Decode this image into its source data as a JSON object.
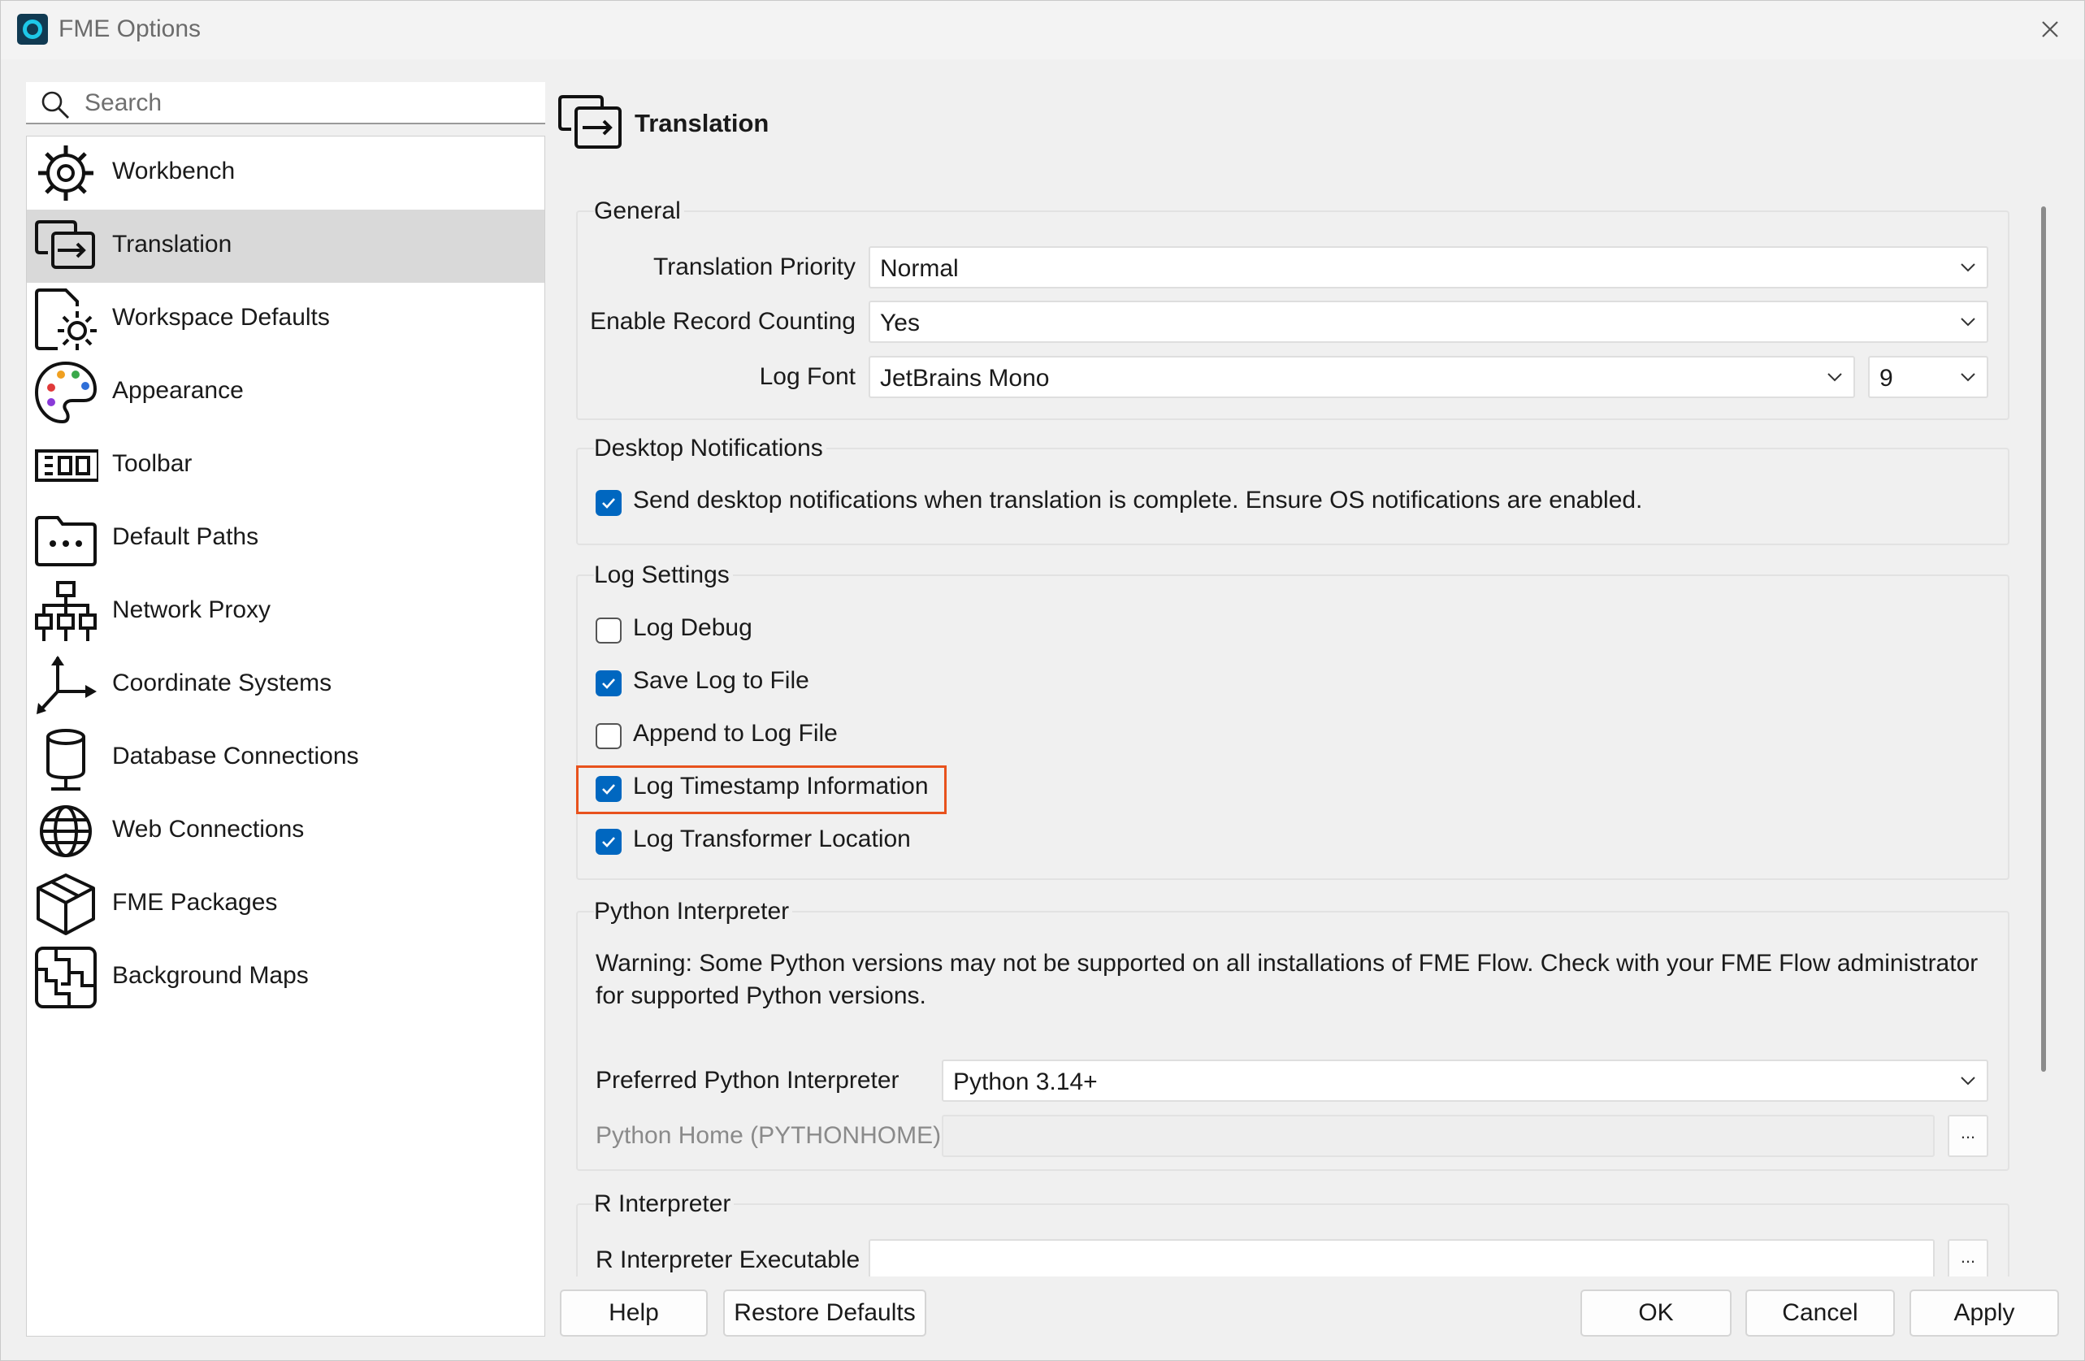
{
  "window": {
    "title": "FME Options"
  },
  "sidebar": {
    "search_placeholder": "Search",
    "items": [
      {
        "label": "Workbench",
        "icon": "workbench-icon"
      },
      {
        "label": "Translation",
        "icon": "translation-icon",
        "selected": true
      },
      {
        "label": "Workspace Defaults",
        "icon": "workspace-defaults-icon"
      },
      {
        "label": "Appearance",
        "icon": "palette-icon"
      },
      {
        "label": "Toolbar",
        "icon": "toolbar-icon"
      },
      {
        "label": "Default Paths",
        "icon": "folder-icon"
      },
      {
        "label": "Network Proxy",
        "icon": "network-icon"
      },
      {
        "label": "Coordinate Systems",
        "icon": "axes-icon"
      },
      {
        "label": "Database Connections",
        "icon": "database-icon"
      },
      {
        "label": "Web Connections",
        "icon": "globe-icon"
      },
      {
        "label": "FME Packages",
        "icon": "package-icon"
      },
      {
        "label": "Background Maps",
        "icon": "map-icon"
      }
    ]
  },
  "page": {
    "title": "Translation",
    "general": {
      "title": "General",
      "translation_priority": {
        "label": "Translation Priority",
        "value": "Normal"
      },
      "record_counting": {
        "label": "Enable Record Counting",
        "value": "Yes"
      },
      "log_font": {
        "label": "Log Font",
        "value": "JetBrains Mono",
        "size": "9"
      }
    },
    "desktop_notifications": {
      "title": "Desktop Notifications",
      "send_label": "Send desktop notifications when translation is complete. Ensure OS notifications are enabled.",
      "send_checked": true
    },
    "log_settings": {
      "title": "Log Settings",
      "options": [
        {
          "label": "Log Debug",
          "checked": false
        },
        {
          "label": "Save Log to File",
          "checked": true
        },
        {
          "label": "Append to Log File",
          "checked": false
        },
        {
          "label": "Log Timestamp Information",
          "checked": true,
          "highlighted": true
        },
        {
          "label": "Log Transformer Location",
          "checked": true
        }
      ]
    },
    "python": {
      "title": "Python Interpreter",
      "warning": "Warning: Some Python versions may not be supported on all installations of FME Flow. Check with your FME Flow administrator for supported Python versions.",
      "preferred_label": "Preferred Python Interpreter",
      "preferred_value": "Python 3.14+",
      "home_label": "Python Home (PYTHONHOME)",
      "home_value": "",
      "browse": "..."
    },
    "r": {
      "title": "R Interpreter",
      "exe_label": "R Interpreter Executable",
      "exe_value": "",
      "browse": "..."
    }
  },
  "buttons": {
    "help": "Help",
    "restore": "Restore Defaults",
    "ok": "OK",
    "cancel": "Cancel",
    "apply": "Apply"
  },
  "colors": {
    "accent": "#0067c0",
    "highlight": "#e8521d",
    "selected_bg": "#d9d9d9"
  }
}
